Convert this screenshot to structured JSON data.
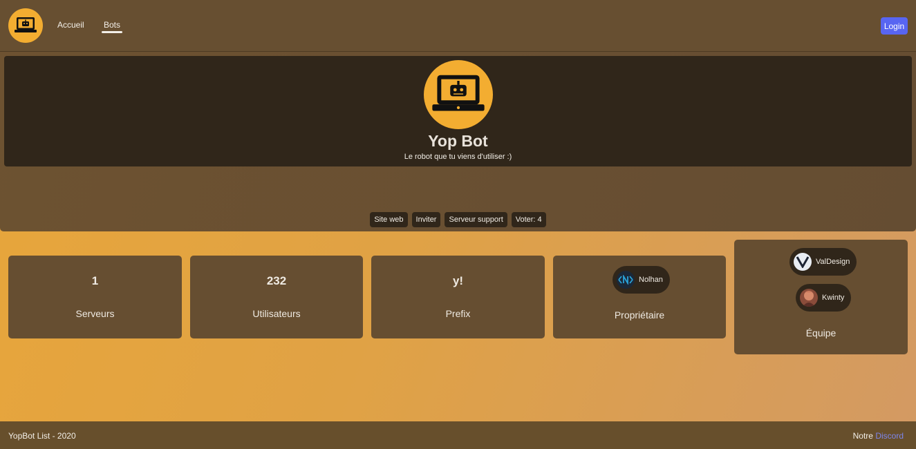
{
  "nav": {
    "links": [
      {
        "label": "Accueil"
      },
      {
        "label": "Bots"
      }
    ],
    "login_label": "Login"
  },
  "bot": {
    "name": "Yop Bot",
    "description": "Le robot que tu viens d'utiliser :)",
    "actions": [
      {
        "label": "Site web"
      },
      {
        "label": "Inviter"
      },
      {
        "label": "Serveur support"
      },
      {
        "label": "Voter: 4"
      }
    ]
  },
  "stats": [
    {
      "value": "1",
      "label": "Serveurs"
    },
    {
      "value": "232",
      "label": "Utilisateurs"
    },
    {
      "value": "y!",
      "label": "Prefix"
    }
  ],
  "owner": {
    "label": "Propriétaire",
    "name": "Nolhan"
  },
  "team": {
    "label": "Équipe",
    "members": [
      {
        "name": "ValDesign"
      },
      {
        "name": "Kwinty"
      }
    ]
  },
  "footer": {
    "copyright": "YopBot List - 2020",
    "notre": "Notre",
    "discord": "Discord"
  },
  "colors": {
    "accent": "#f3ad31",
    "login": "#5865f2",
    "discord_link": "#7d86ec",
    "card": "#664e31",
    "pill": "#30261a"
  }
}
